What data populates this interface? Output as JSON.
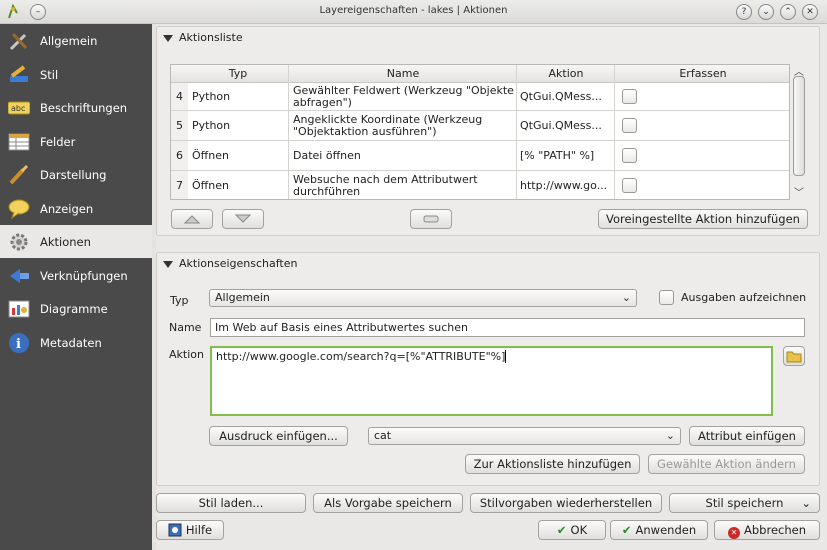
{
  "window": {
    "title": "Layereigenschaften - lakes | Aktionen"
  },
  "sidebar": {
    "items": [
      {
        "label": "Allgemein"
      },
      {
        "label": "Stil"
      },
      {
        "label": "Beschriftungen"
      },
      {
        "label": "Felder"
      },
      {
        "label": "Darstellung"
      },
      {
        "label": "Anzeigen"
      },
      {
        "label": "Aktionen"
      },
      {
        "label": "Verknüpfungen"
      },
      {
        "label": "Diagramme"
      },
      {
        "label": "Metadaten"
      }
    ]
  },
  "actions_list": {
    "title": "Aktionsliste",
    "columns": [
      "Typ",
      "Name",
      "Aktion",
      "Erfassen"
    ],
    "rows": [
      {
        "num": "4",
        "type": "Python",
        "name": "Gewählter Feldwert (Werkzeug \"Objekte abfragen\")",
        "action": "QtGui.QMess...",
        "capture": false
      },
      {
        "num": "5",
        "type": "Python",
        "name": "Angeklickte Koordinate (Werkzeug \"Objektaktion ausführen\")",
        "action": "QtGui.QMess...",
        "capture": false
      },
      {
        "num": "6",
        "type": "Öffnen",
        "name": "Datei öffnen",
        "action": "[% \"PATH\" %]",
        "capture": false
      },
      {
        "num": "7",
        "type": "Öffnen",
        "name": "Websuche nach dem Attributwert durchführen",
        "action": "http://www.go...",
        "capture": false
      }
    ],
    "add_default_label": "Voreingestellte Aktion hinzufügen"
  },
  "action_props": {
    "title": "Aktionseigenschaften",
    "type_label": "Typ",
    "type_value": "Allgemein",
    "capture_output_label": "Ausgaben aufzeichnen",
    "name_label": "Name",
    "name_value": "Im Web auf Basis eines Attributwertes suchen",
    "action_label": "Aktion",
    "action_value": "http://www.google.com/search?q=[%\"ATTRIBUTE\"%]",
    "insert_expression_label": "Ausdruck einfügen...",
    "attribute_value": "cat",
    "insert_attribute_label": "Attribut einfügen",
    "add_to_list_label": "Zur Aktionsliste hinzufügen",
    "update_action_label": "Gewählte Aktion ändern"
  },
  "style_bar": {
    "load_label": "Stil laden...",
    "save_default_label": "Als Vorgabe speichern",
    "restore_label": "Stilvorgaben wiederherstellen",
    "save_label": "Stil speichern"
  },
  "footer": {
    "help_label": "Hilfe",
    "ok_label": "OK",
    "apply_label": "Anwenden",
    "cancel_label": "Abbrechen"
  }
}
